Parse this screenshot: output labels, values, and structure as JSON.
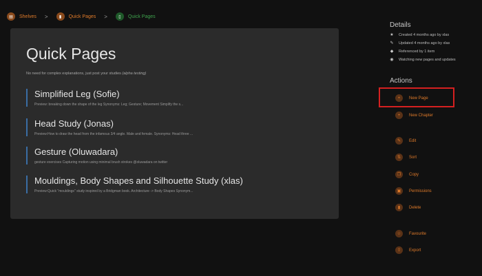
{
  "breadcrumb": {
    "shelves": "Shelves",
    "chapter": "Quick Pages",
    "current": "Quick Pages",
    "separator": ">"
  },
  "book": {
    "title": "Quick Pages",
    "description": "No need for complex explanations, just post your studies",
    "description_note": "(alpha testing)"
  },
  "pages": [
    {
      "title": "Simplified Leg (Sofie)",
      "preview": "Preview: breaking down the shape of the leg Synonyms: Leg; Gesture; Movement Simplify the s..."
    },
    {
      "title": "Head Study (Jonas)",
      "preview": "Preview:How to draw the head from the infamous 3/4 angle. Male and female. Synonyms: Head three ..."
    },
    {
      "title": "Gesture (Oluwadara)",
      "preview": "gesture exercises Capturing motion using minimal brush strokes @oluwadara on twitter"
    },
    {
      "title": "Mouldings, Body Shapes and Silhouette Study (xlas)",
      "preview": "Preview:Quick \"mouldings\" study inspired by a Bridgman book. Architecture -> Body Shapes Synonym..."
    }
  ],
  "details": {
    "title": "Details",
    "created": "Created 4 months ago by xlas",
    "updated": "Updated 4 months ago by xlas",
    "referenced": "Referenced by 1 item",
    "watching": "Watching new pages and updates"
  },
  "actions": {
    "title": "Actions",
    "new_page": "New Page",
    "new_chapter": "New Chapter",
    "edit": "Edit",
    "sort": "Sort",
    "copy": "Copy",
    "permissions": "Permissions",
    "delete": "Delete",
    "favourite": "Favourite",
    "export": "Export"
  },
  "colors": {
    "accent": "#e07b2a",
    "current_crumb": "#3fa34d",
    "page_border": "#3a6ea5",
    "highlight": "#d62020"
  }
}
